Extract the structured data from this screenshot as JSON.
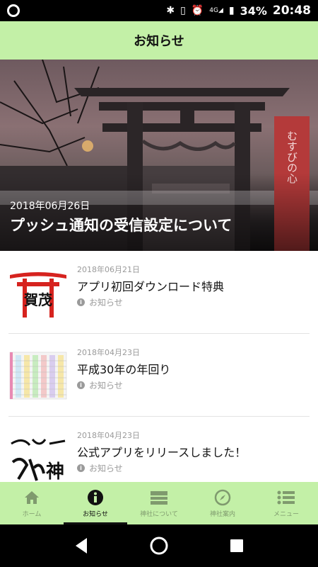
{
  "status_bar": {
    "battery": "34%",
    "time": "20:48",
    "network": "4G"
  },
  "header": {
    "title": "お知らせ"
  },
  "hero": {
    "date": "2018年06月26日",
    "title": "プッシュ通知の受信設定について",
    "banner_text": "むすびの心"
  },
  "news": [
    {
      "date": "2018年06月21日",
      "title": "アプリ初回ダウンロード特典",
      "category": "お知らせ",
      "thumb_text": "賀茂"
    },
    {
      "date": "2018年04月23日",
      "title": "平成30年の年回り",
      "category": "お知らせ"
    },
    {
      "date": "2018年04月23日",
      "title": "公式アプリをリリースしました！",
      "category": "お知らせ",
      "thumb_text": "神"
    }
  ],
  "tabs": [
    {
      "label": "ホーム",
      "icon": "home-icon",
      "active": false
    },
    {
      "label": "お知らせ",
      "icon": "info-icon",
      "active": true
    },
    {
      "label": "神社について",
      "icon": "shrine-icon",
      "active": false
    },
    {
      "label": "神社案内",
      "icon": "compass-icon",
      "active": false
    },
    {
      "label": "メニュー",
      "icon": "menu-icon",
      "active": false
    }
  ]
}
